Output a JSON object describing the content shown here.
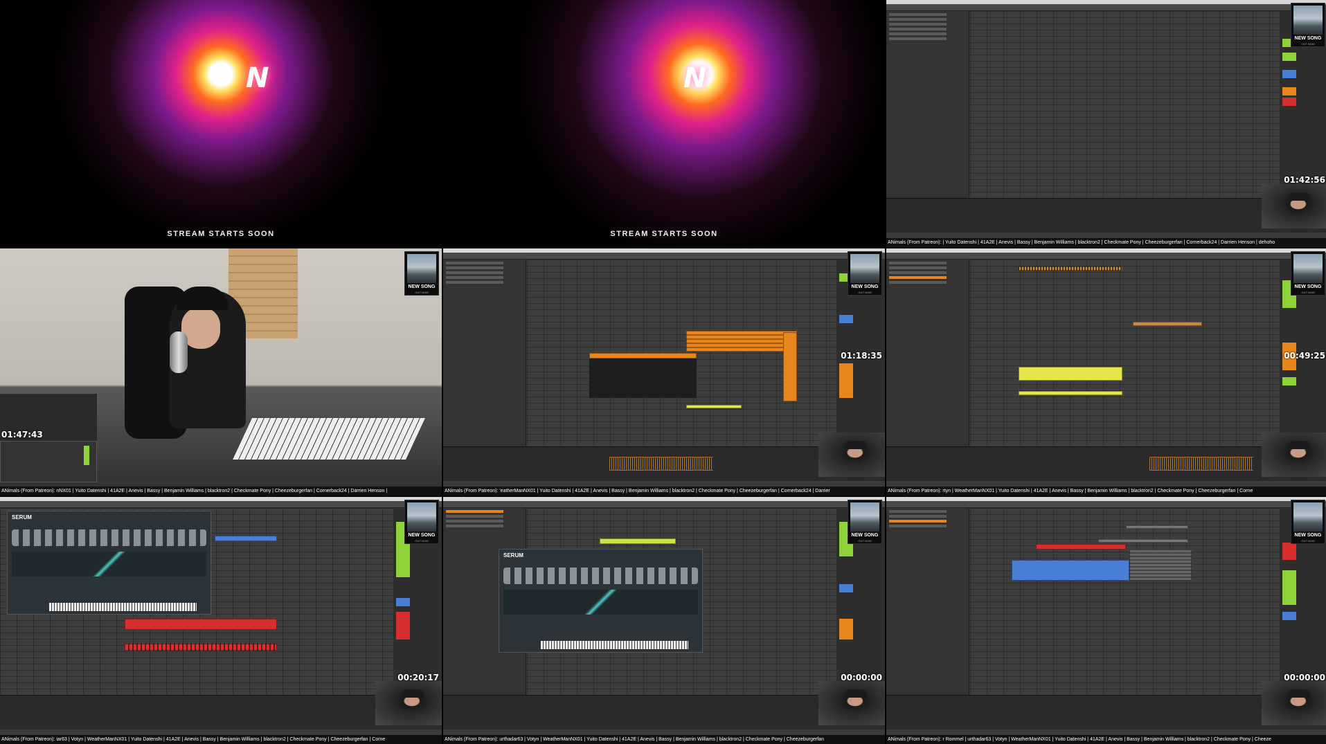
{
  "intro": {
    "stream_text": "STREAM STARTS SOON",
    "logo": "N"
  },
  "badge": {
    "title": "NEW SONG",
    "subtitle": "OUT NOW"
  },
  "tiles": [
    {
      "id": "t3",
      "timecode": "01:42:56",
      "ticker": "ANimals (From Patreon): | Yuito Datenshi | 41A2E | Anevis | Bassy | Benjamin Williams | blacktron2 | Checkmate Pony | Cheezeburgerfan | Cornerback24 | Darrien Henson | dehoho"
    },
    {
      "id": "t4",
      "timecode": "01:47:43",
      "ticker": "ANimals (From Patreon): nNX01 | Yuito Datenshi | 41A2E | Anevis | Bassy | Benjamin Williams | blacktron2 | Checkmate Pony | Cheezeburgerfan | Cornerback24 | Darrien Henson |"
    },
    {
      "id": "t5",
      "timecode": "01:18:35",
      "ticker": "ANimals (From Patreon): 'eatherManNX01 | Yuito Datenshi | 41A2E | Anevis | Bassy | Benjamin Williams | blacktron2 | Checkmate Pony | Cheezeburgerfan | Cornerback24 | Darrier"
    },
    {
      "id": "t6",
      "timecode": "00:49:25",
      "ticker": "ANimals (From Patreon): rtyn | WeatherManNX01 | Yuito Datenshi | 41A2E | Anevis | Bassy | Benjamin Williams | blacktron2 | Checkmate Pony | Cheezeburgerfan | Corne"
    },
    {
      "id": "t7",
      "timecode": "00:20:17",
      "ticker": "ANimals (From Patreon): iar63 | Votyn | WeatherManNX01 | Yuito Datenshi | 41A2E | Anevis | Bassy | Benjamin Williams | blacktron2 | Checkmate Pony | Cheezeburgerfan | Corne"
    },
    {
      "id": "t8",
      "timecode": "00:00:00",
      "ticker": "ANimals (From Patreon): urthadar63 | Votyn | WeatherManNX01 | Yuito Datenshi | 41A2E | Anevis | Bassy | Benjamin Williams | blacktron2 | Checkmate Pony | Cheezeburgerfan"
    },
    {
      "id": "t9",
      "timecode": "00:00:00",
      "ticker": "ANimals (From Patreon): r Rommel | urthadar63 | Votyn | WeatherManNX01 | Yuito Datenshi | 41A2E | Anevis | Bassy | Benjamin Williams | blacktron2 | Checkmate Pony | Cheeze"
    }
  ],
  "colors": {
    "clip_orange": "#e8861e",
    "clip_yellow": "#e6e64a",
    "clip_red": "#d83030",
    "clip_blue": "#4a7fd8",
    "clip_green": "#7fd33a",
    "meter_green": "#8fd33a"
  },
  "plugin": {
    "name": "SERUM"
  }
}
